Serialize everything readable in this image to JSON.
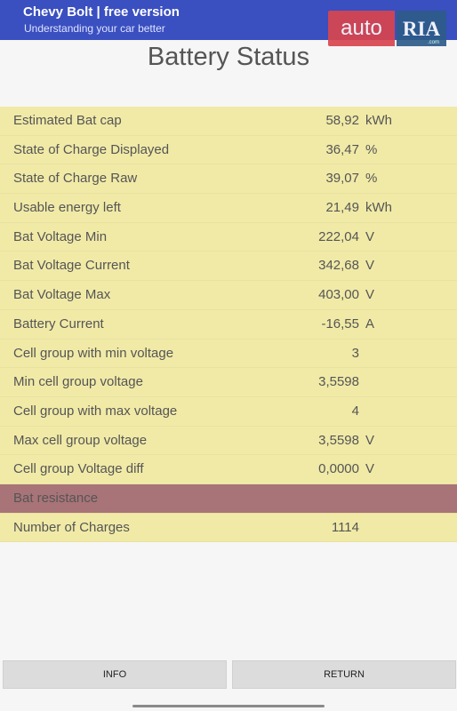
{
  "app_bar": {
    "title": "Chevy Bolt | free version",
    "subtitle": "Understanding your car better"
  },
  "watermark": {
    "part1": "auto",
    "part2": "RIA",
    "suffix": ".com"
  },
  "page": {
    "title": "Battery Status"
  },
  "rows": [
    {
      "label": "Estimated Bat cap",
      "value": "58,92",
      "unit": "kWh"
    },
    {
      "label": "State of Charge Displayed",
      "value": "36,47",
      "unit": "%"
    },
    {
      "label": "State of Charge Raw",
      "value": "39,07",
      "unit": "%"
    },
    {
      "label": "Usable energy left",
      "value": "21,49",
      "unit": "kWh"
    },
    {
      "label": "Bat Voltage Min",
      "value": "222,04",
      "unit": "V"
    },
    {
      "label": "Bat Voltage Current",
      "value": "342,68",
      "unit": "V"
    },
    {
      "label": "Bat Voltage Max",
      "value": "403,00",
      "unit": "V"
    },
    {
      "label": "Battery Current",
      "value": "-16,55",
      "unit": "A"
    },
    {
      "label": "Cell group with min voltage",
      "value": "3",
      "unit": ""
    },
    {
      "label": "Min cell group voltage",
      "value": "3,5598",
      "unit": ""
    },
    {
      "label": "Cell group with max voltage",
      "value": "4",
      "unit": ""
    },
    {
      "label": "Max cell group voltage",
      "value": "3,5598",
      "unit": "V"
    },
    {
      "label": "Cell group Voltage diff",
      "value": "0,0000",
      "unit": "V"
    },
    {
      "label": "Bat resistance",
      "value": "",
      "unit": ""
    },
    {
      "label": "Number of Charges",
      "value": "1114",
      "unit": ""
    }
  ],
  "colors": {
    "row_bg": "#f1eaa7",
    "highlight_bg": "#a87478",
    "app_bar": "#3a4fc0"
  },
  "buttons": {
    "info": "INFO",
    "return": "RETURN"
  }
}
